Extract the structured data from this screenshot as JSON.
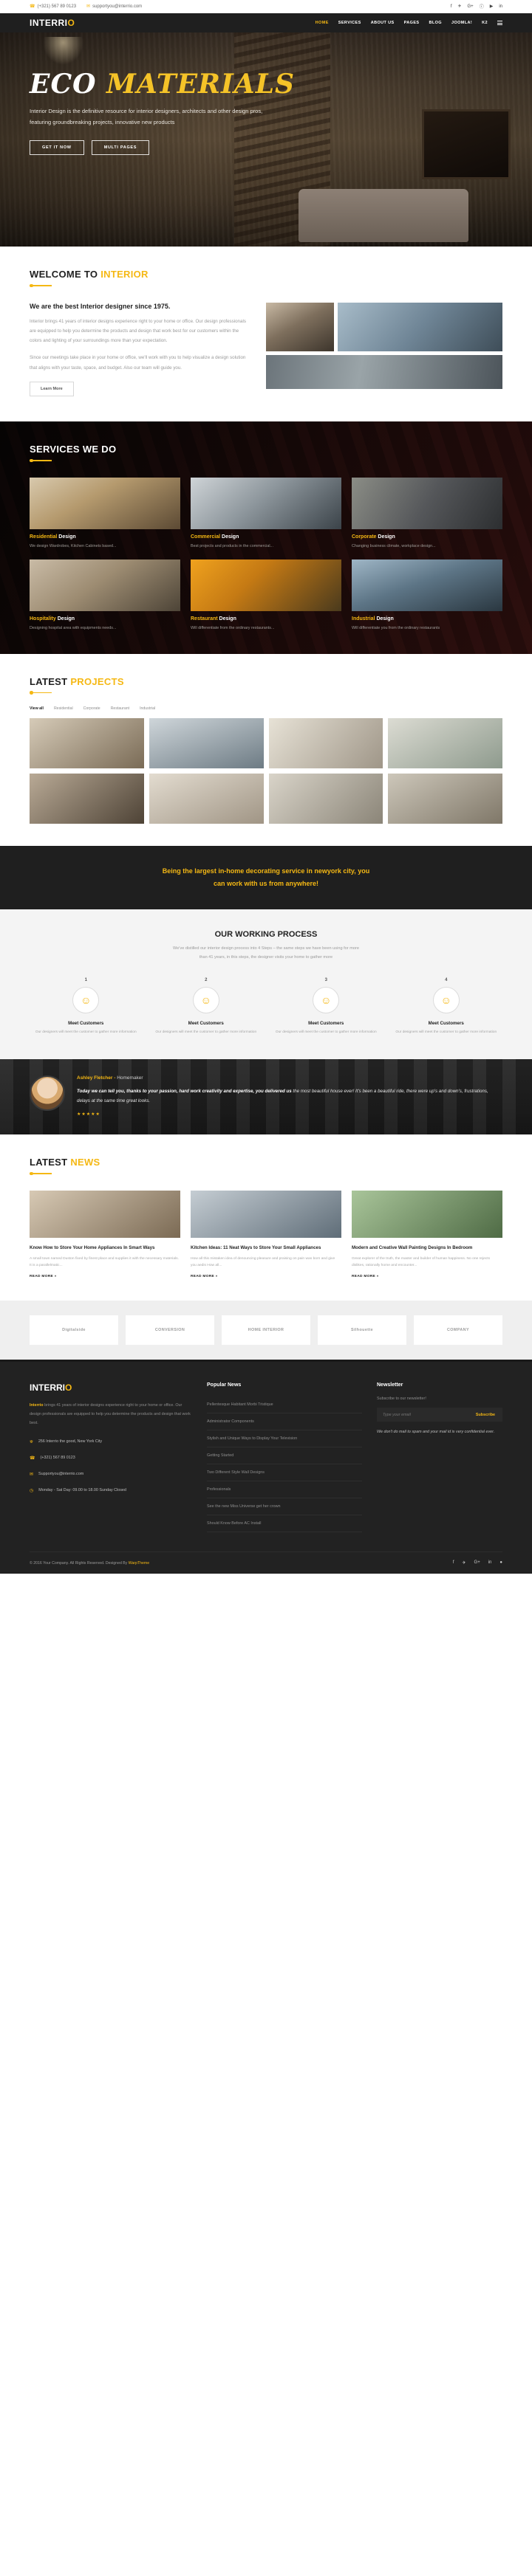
{
  "topbar": {
    "phone": "(+321) 567 89 0123",
    "email": "supportyou@interrio.com",
    "socials": [
      "f",
      "✈",
      "G+",
      "ⓘ",
      "▶",
      "in"
    ]
  },
  "header": {
    "logo_main": "INTERRI",
    "logo_dot": "O",
    "nav": [
      {
        "label": "HOME",
        "active": true
      },
      {
        "label": "SERVICES",
        "active": false
      },
      {
        "label": "ABOUT US",
        "active": false
      },
      {
        "label": "PAGES",
        "active": false
      },
      {
        "label": "BLOG",
        "active": false
      },
      {
        "label": "JOOMLA!",
        "active": false
      },
      {
        "label": "K2",
        "active": false
      }
    ]
  },
  "hero": {
    "title_white": "ECO",
    "title_yellow": "MATERIALS",
    "subtitle": "Interior Design is the definitive resource for interior designers, architects and other design pros, featuring groundbreaking projects, innovative new products",
    "btn_primary": "GET IT NOW",
    "btn_secondary": "MULTI PAGES"
  },
  "welcome": {
    "title_dark": "WELCOME TO",
    "title_light": "INTERIOR",
    "heading": "We are the best Interior designer since 1975.",
    "p1": "Interior brings 41 years of interior designs experience right to your home or office. Our design professionals are equipped to help you determine the products and design that work best for our customers within the colors and lighting of your surroundings more than your expectation.",
    "p2": "Since our meetings take place in your home or office, we'll work with you to help visualize a design solution that aligns with your taste, space, and budget. Also our team will guide you.",
    "button": "Learn More"
  },
  "services": {
    "title_light": "SERVICES WE DO",
    "items": [
      {
        "name": "Residential",
        "suffix": " Design",
        "desc": "We design Wardrobes, Kitchen Cabinets based..."
      },
      {
        "name": "Commercial",
        "suffix": " Design",
        "desc": "Best projects and products in the commercial..."
      },
      {
        "name": "Corporate",
        "suffix": " Design",
        "desc": "Changing business climate, workplace design..."
      },
      {
        "name": "Hospitality",
        "suffix": " Design",
        "desc": "Designing hospital area with equipments needs..."
      },
      {
        "name": "Restaurant",
        "suffix": " Design",
        "desc": "Will differentiate from the ordinary restaurants..."
      },
      {
        "name": "Industrial",
        "suffix": " Design",
        "desc": "Will differentiate you from the ordinary restaurants"
      }
    ]
  },
  "projects": {
    "title_dark": "LATEST",
    "title_light": "PROJECTS",
    "filters": [
      {
        "label": "View all",
        "active": true
      },
      {
        "label": "Residential",
        "active": false
      },
      {
        "label": "Corporate",
        "active": false
      },
      {
        "label": "Restaurant",
        "active": false
      },
      {
        "label": "Industrial",
        "active": false
      }
    ]
  },
  "cta": {
    "line1": "Being the largest in-home decorating service in newyork city, you",
    "line2": "can work with us from anywhere!"
  },
  "process": {
    "title": "OUR WORKING PROCESS",
    "subtitle_l1": "We've distilled our interior design process into 4 Steps – the same steps we have been using for more",
    "subtitle_l2": "than 41 years, in this steps, the designer visits your home to gather more",
    "steps": [
      {
        "num": "1",
        "title": "Meet Customers",
        "desc": "Our designers will meet the customer to gather more information"
      },
      {
        "num": "2",
        "title": "Meet Customers",
        "desc": "Our designers will meet the customer to gather more information"
      },
      {
        "num": "3",
        "title": "Meet Customers",
        "desc": "Our designers will meet the customer to gather more information"
      },
      {
        "num": "4",
        "title": "Meet Customers",
        "desc": "Our designers will meet the customer to gather more information"
      }
    ]
  },
  "testimonial": {
    "name": "Ashley Fletcher - ",
    "role": "Homemaker",
    "quote_lead": "Today we can tell you, thanks to your passion, hard work creativity and expertise, you delivered us",
    "quote_rest": "the most beautiful house ever! It's been a beautiful ride, there were up's and down's, frustrations, delays at the same time great looks.",
    "stars": "★★★★★"
  },
  "news": {
    "title_dark": "LATEST",
    "title_light": "NEWS",
    "items": [
      {
        "title": "Know How to Store Your Home Appliances In Smart Ways",
        "desc": "A small town named Duston fixed by finest place and supplies it with the necessary materials. It is a parallelmatic...",
        "link": "READ MORE »"
      },
      {
        "title": "Kitchen Ideas: 11 Neat Ways to Store Your Small Appliances",
        "desc": "How all this mistaken idea of denouncing pleasure and praising on pain was born and give you aedis How all...",
        "link": "READ MORE »"
      },
      {
        "title": "Modern and Creative Wall Painting Designs In Bedroom",
        "desc": "Great explorer of the truth, the master and builder of human happiness. No one rejects dislikes, rationally home and encounter...",
        "link": "READ MORE »"
      }
    ]
  },
  "brands": [
    "Digitalside",
    "CONVERSION",
    "HOME INTERIOR",
    "Silhouette",
    "COMPANY"
  ],
  "footer": {
    "logo_main": "INTERRI",
    "logo_dot": "O",
    "about_brand": "Interrio",
    "about_text": " brings 41 years of interior designs experience right to your home or office. Our design professionals are equipped to help you determine the products and design that work best.",
    "contact": [
      {
        "icon": "location-icon",
        "glyph": "⛯",
        "text": "256 Interrio the good, New York City"
      },
      {
        "icon": "phone-icon",
        "glyph": "☎",
        "text": "(+321) 567 89 0123"
      },
      {
        "icon": "mail-icon",
        "glyph": "✉",
        "text": "Supportyou@interrio.com"
      },
      {
        "icon": "clock-icon",
        "glyph": "◷",
        "text": "Monday - Sat Day: 09.00 to 18.00 Sunday Closed"
      }
    ],
    "popular_news_title": "Popular News",
    "popular_news": [
      "Pellentesque Habitant Morbi Tristique",
      "Administrator Components",
      "Stylish and Unique Ways to Display Your Television",
      "Getting Started",
      "Two Different Style Wall Designs",
      "Professionals",
      "See the new Miss Universe get her crown",
      "Should Know Before AC Install"
    ],
    "newsletter_title": "Newsletter",
    "newsletter_sub": "Subscribe to our newsletter!",
    "email_placeholder": "Type your email",
    "subscribe_label": "Subscribe",
    "newsletter_note": "We don't do mail to spam and your mail id is very confidential ever.",
    "copyright_pre": "© 2016 Your Company. All Rights Reserved. Designed By ",
    "copyright_brand": "WarpTheme",
    "socials": [
      "f",
      "✈",
      "G+",
      "in",
      "●"
    ]
  },
  "colors": {
    "accent": "#f5b814",
    "dark": "#1f1f1f",
    "footer_bg": "#222222"
  }
}
